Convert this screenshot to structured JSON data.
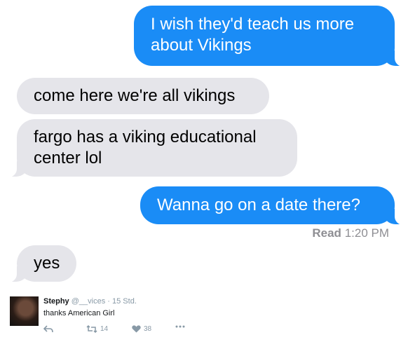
{
  "messages": [
    {
      "side": "sent",
      "text_lines": [
        "I wish they'd teach us more",
        "about Vikings"
      ]
    },
    {
      "side": "received",
      "text_lines": [
        "come here we're all vikings"
      ]
    },
    {
      "side": "received",
      "text_lines": [
        "fargo has a viking educational",
        "center lol"
      ]
    },
    {
      "side": "sent",
      "text_lines": [
        "Wanna go on a date there?"
      ]
    },
    {
      "side": "received",
      "text_lines": [
        "yes"
      ]
    }
  ],
  "read_receipt": {
    "label": "Read",
    "time": "1:20 PM"
  },
  "tweet": {
    "name": "Stephy",
    "handle": "@__vices",
    "separator": "·",
    "age": "15 Std.",
    "text": "thanks American Girl",
    "retweets": "14",
    "likes": "38"
  },
  "icons": {
    "reply": "reply-icon",
    "retweet": "retweet-icon",
    "like": "heart-icon",
    "more": "more-icon"
  },
  "colors": {
    "sent_bubble": "#1a8cf6",
    "received_bubble": "#e5e5ea",
    "meta_text": "#8e8e93"
  }
}
